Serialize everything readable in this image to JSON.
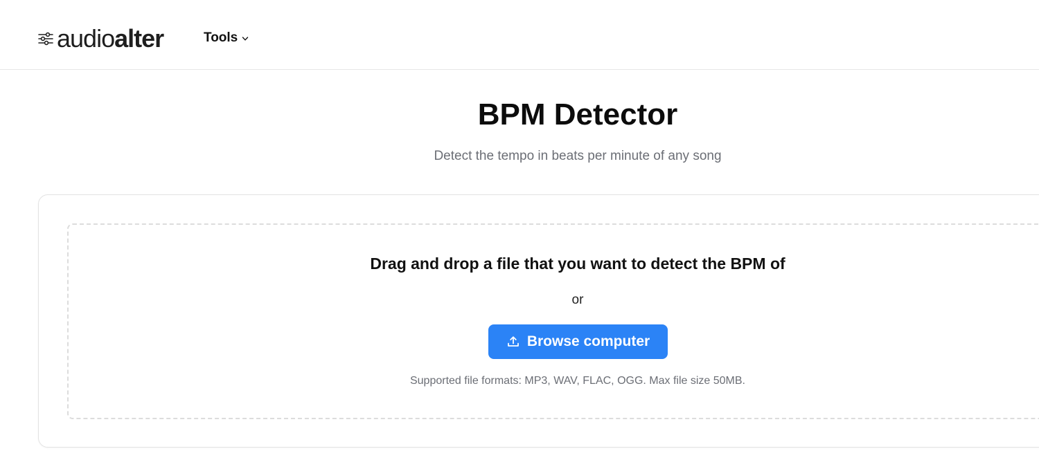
{
  "header": {
    "logo": {
      "part1": "audio",
      "part2": "alter",
      "icon": "sliders-icon"
    },
    "tools_label": "Tools",
    "tools_icon": "chevron-down-icon"
  },
  "hero": {
    "title": "BPM Detector",
    "subtitle": "Detect the tempo in beats per minute of any song"
  },
  "upload": {
    "heading": "Drag and drop a file that you want to detect the BPM of",
    "or_text": "or",
    "browse_label": "Browse computer",
    "browse_icon": "upload-icon",
    "formats_text": "Supported file formats: MP3, WAV, FLAC, OGG. Max file size 50MB."
  },
  "colors": {
    "accent": "#2b83f6",
    "muted_text": "#6b6e75",
    "border": "#e2e2e2"
  }
}
